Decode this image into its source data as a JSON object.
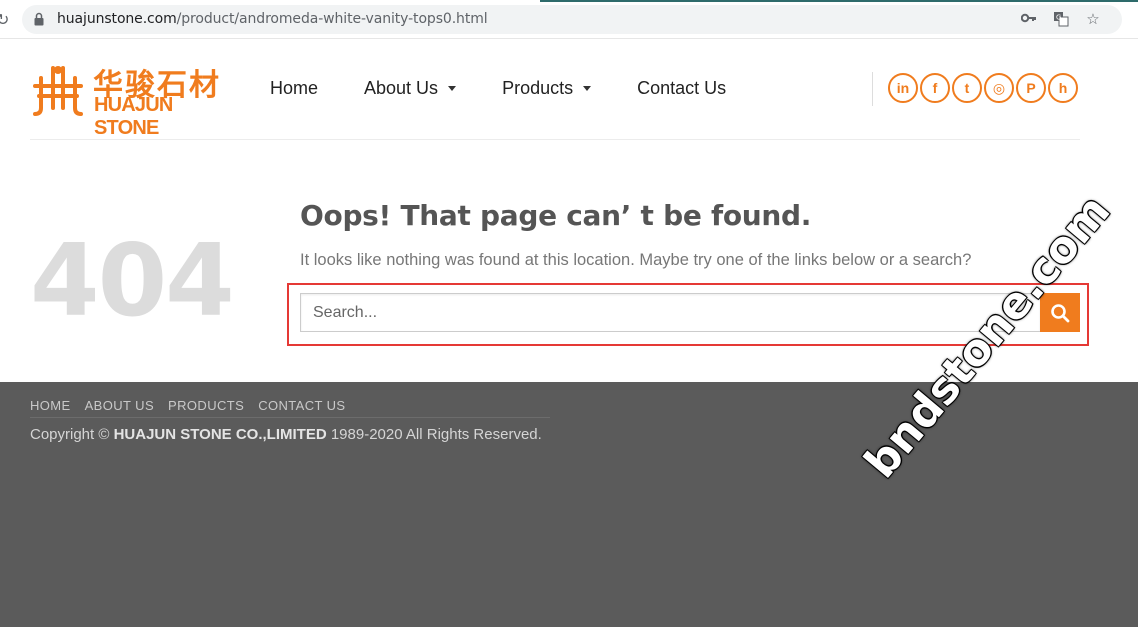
{
  "browser": {
    "url_host": "huajunstone.com",
    "url_path": "/product/andromeda-white-vanity-tops0.html",
    "icons": [
      "reload-icon",
      "lock-icon",
      "key-icon",
      "translate-icon",
      "star-icon"
    ]
  },
  "logo": {
    "cn": "华骏石材",
    "en": "HUAJUN STONE"
  },
  "nav": {
    "items": [
      {
        "label": "Home",
        "dropdown": false
      },
      {
        "label": "About Us",
        "dropdown": true
      },
      {
        "label": "Products",
        "dropdown": true
      },
      {
        "label": "Contact Us",
        "dropdown": false
      }
    ]
  },
  "social": [
    {
      "name": "linkedin",
      "glyph": "in"
    },
    {
      "name": "facebook",
      "glyph": "f"
    },
    {
      "name": "twitter",
      "glyph": "t"
    },
    {
      "name": "instagram",
      "glyph": "◎"
    },
    {
      "name": "pinterest",
      "glyph": "P"
    },
    {
      "name": "houzz",
      "glyph": "h"
    }
  ],
  "error": {
    "code": "404",
    "title": "Oops! That page can’ t be found.",
    "message": "It looks like nothing was found at this location. Maybe try one of the links below or a search?"
  },
  "search": {
    "placeholder": "Search...",
    "value": ""
  },
  "footer": {
    "nav": [
      "HOME",
      "ABOUT US",
      "PRODUCTS",
      "CONTACT US"
    ],
    "copyright_prefix": "Copyright © ",
    "company": "HUAJUN STONE CO.,LIMITED",
    "copyright_suffix": " 1989-2020 All Rights Reserved."
  },
  "watermark": "bndstone.com",
  "colors": {
    "accent": "#f07c1e",
    "highlight_border": "#e53935",
    "footer_bg": "#5b5b5b"
  }
}
